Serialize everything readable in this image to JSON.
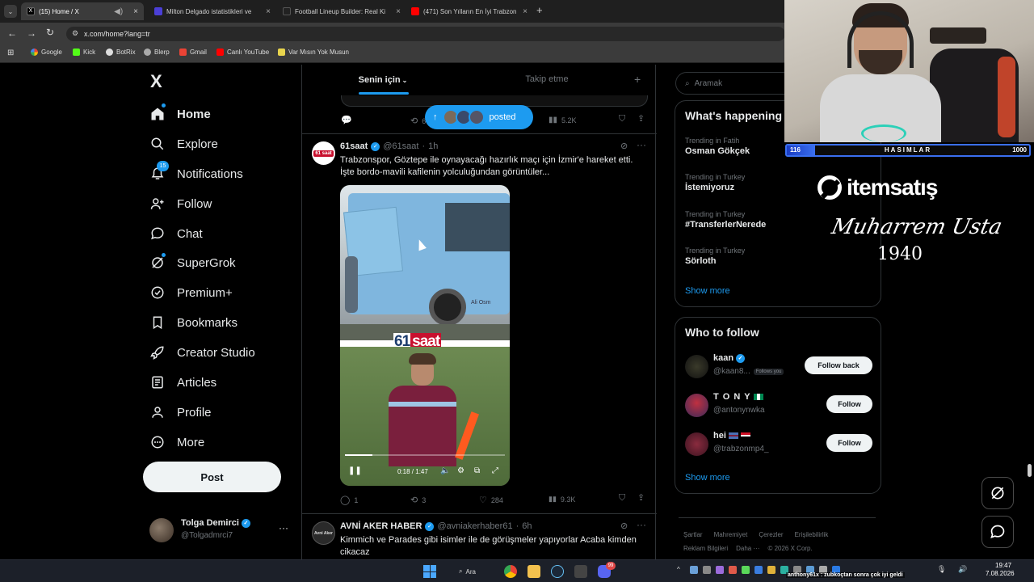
{
  "browser": {
    "tabs": [
      {
        "title": "(15) Home / X",
        "active": true
      },
      {
        "title": "Milton Delgado istatistikleri ve"
      },
      {
        "title": "Football Lineup Builder: Real Ki"
      },
      {
        "title": "(471) Son Yılların En İyi Trabzon"
      }
    ],
    "new_tab_symbol": "+",
    "url": "x.com/home?lang=tr",
    "bookmarks": [
      "Google",
      "Kick",
      "BotRix",
      "Blerp",
      "Gmail",
      "Canlı YouTube",
      "Var Mısın Yok Musun"
    ]
  },
  "sidebar": {
    "logo": "X",
    "nav": [
      {
        "label": "Home",
        "icon": "home-icon",
        "bold": true
      },
      {
        "label": "Explore",
        "icon": "search-icon"
      },
      {
        "label": "Notifications",
        "icon": "bell-icon",
        "badge": "15"
      },
      {
        "label": "Follow",
        "icon": "person-plus-icon"
      },
      {
        "label": "Chat",
        "icon": "chat-icon"
      },
      {
        "label": "SuperGrok",
        "icon": "grok-icon"
      },
      {
        "label": "Premium+",
        "icon": "verified-icon"
      },
      {
        "label": "Bookmarks",
        "icon": "bookmark-icon"
      },
      {
        "label": "Creator Studio",
        "icon": "rocket-icon"
      },
      {
        "label": "Articles",
        "icon": "article-icon"
      },
      {
        "label": "Profile",
        "icon": "person-icon"
      },
      {
        "label": "More",
        "icon": "more-circle-icon"
      }
    ],
    "post_button": "Post",
    "account": {
      "name": "Tolga Demirci",
      "handle": "@Tolgadmrci7",
      "more": "···"
    }
  },
  "feed": {
    "tabs": [
      {
        "label": "Senin için",
        "active": true
      },
      {
        "label": "Takip etme"
      }
    ],
    "add_tab": "+",
    "new_posts_pill": "posted",
    "prev_post_metrics": {
      "retweets": "6",
      "views": "5.2K"
    },
    "post1": {
      "author": "61saat",
      "avatar_text": "61 saat",
      "handle": "@61saat",
      "time": "1h",
      "text_line1": "Trabzonspor, Göztepe ile oynayacağı hazırlık maçı için İzmir'e hareket etti.",
      "text_line2": "İşte bordo-mavili kafilenin yolculuğundan görüntüler...",
      "video_overlay_brand_a": "61",
      "video_overlay_brand_b": "saat",
      "video_bus_text": "Ali Osm",
      "video_time": "0:18 / 1:47",
      "replies": "1",
      "retweets": "3",
      "likes": "284",
      "views": "9.3K"
    },
    "post2": {
      "author": "AVNİ AKER HABER",
      "avatar_text": "Avni Aker",
      "handle": "@avniakerhaber61",
      "time": "6h",
      "text_line1": "Kimmich ve Parades gibi isimler ile de görüşmeler yapıyorlar Acaba kimden",
      "text_line2": "cikacaz"
    }
  },
  "right": {
    "search_placeholder": "Aramak",
    "happening_title": "What's happening",
    "trends": [
      {
        "context": "Trending in Fatih",
        "name": "Osman Gökçek"
      },
      {
        "context": "Trending in Turkey",
        "name": "İstemiyoruz"
      },
      {
        "context": "Trending in Turkey",
        "name": "#TransferlerNerede"
      },
      {
        "context": "Trending in Turkey",
        "name": "Sörloth"
      }
    ],
    "trend_more": "···",
    "show_more": "Show more",
    "who_to_follow": "Who to follow",
    "follow_suggestions": [
      {
        "name": "kaan",
        "handle": "@kaan8...",
        "tag": "Follows you",
        "button": "Follow back",
        "verified": true
      },
      {
        "name": "T O N Y",
        "handle": "@antonynwka",
        "button": "Follow"
      },
      {
        "name": "hei",
        "handle": "@trabzonmp4_",
        "button": "Follow"
      }
    ],
    "show_more_2": "Show more",
    "footer_row1": [
      "Şartlar",
      "Mahremiyet",
      "Çerezler",
      "Erişilebilirlik"
    ],
    "footer_row2": [
      "Reklam Bilgileri",
      "Daha ···",
      "© 2026 X Corp."
    ]
  },
  "stream_overlay": {
    "bar_left": "116",
    "bar_title": "HASIMLAR",
    "bar_right": "1000",
    "bar_fraction": 0.116,
    "sponsor": "itemsatış",
    "signature": "Muharrem Usta",
    "signature_year": "1940",
    "chat_message": "anthony61x : zubkoçtan sonra çok iyi geldi"
  },
  "taskbar": {
    "search": "Ara",
    "discord_badge": "99",
    "time": "19:47",
    "date": "7.08.2026"
  },
  "colors": {
    "accent": "#1d9bf0",
    "verified": "#1d9bf0",
    "pill": "#1d9bf0",
    "text_secondary": "#71767b"
  }
}
